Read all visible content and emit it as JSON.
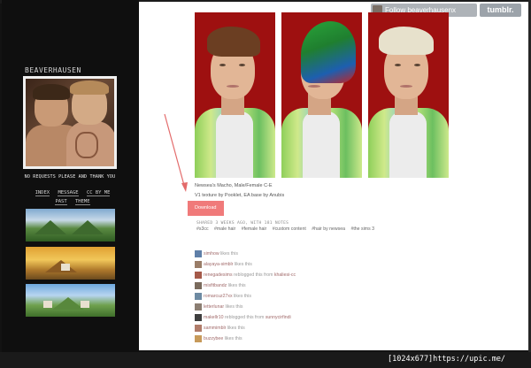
{
  "sidebar": {
    "blog_title": "BEAVERHAUSEN",
    "tagline": "NO REQUESTS PLEASE AND THANK YOU",
    "nav": {
      "row1": [
        "INDEX",
        "MESSAGE",
        "CC BY ME"
      ],
      "row2": [
        "PAST",
        "THEME"
      ]
    }
  },
  "header": {
    "follow_label": "Follow beaverhausenx",
    "tumblr_label": "tumblr."
  },
  "post": {
    "caption_line1": "Newsea's Macho, Male/Female C-E",
    "caption_line2": "V1 texture by Pooklet, EA base by Anubis",
    "download_label": "Download",
    "meta": "SHARED 3 WEEKS AGO, WITH 181 NOTES",
    "tags": [
      "#s3cc",
      "#male hair",
      "#female hair",
      "#custom content",
      "#hair by newsea",
      "#the sims 3"
    ]
  },
  "notes": [
    {
      "user": "simhow",
      "action": "likes this",
      "source": ""
    },
    {
      "user": "alayaya-simblr",
      "action": "likes this",
      "source": ""
    },
    {
      "user": "renegadesims",
      "action": "reblogged this from",
      "source": "khaliesi-cc"
    },
    {
      "user": "misfitbandz",
      "action": "likes this",
      "source": ""
    },
    {
      "user": "romarcuz27xx",
      "action": "likes this",
      "source": ""
    },
    {
      "user": "letterlunar",
      "action": "likes this",
      "source": ""
    },
    {
      "user": "makellr10",
      "action": "reblogged this from",
      "source": "sunnycirfindi"
    },
    {
      "user": "sammimblr",
      "action": "likes this",
      "source": ""
    },
    {
      "user": "buzzybee",
      "action": "likes this",
      "source": ""
    }
  ],
  "footer": {
    "label": "[1024x677]https://upic.me/"
  },
  "colors": {
    "download_button": "#f07a7a",
    "panel_red": "#9e1010",
    "arrow": "#e36b6b"
  }
}
